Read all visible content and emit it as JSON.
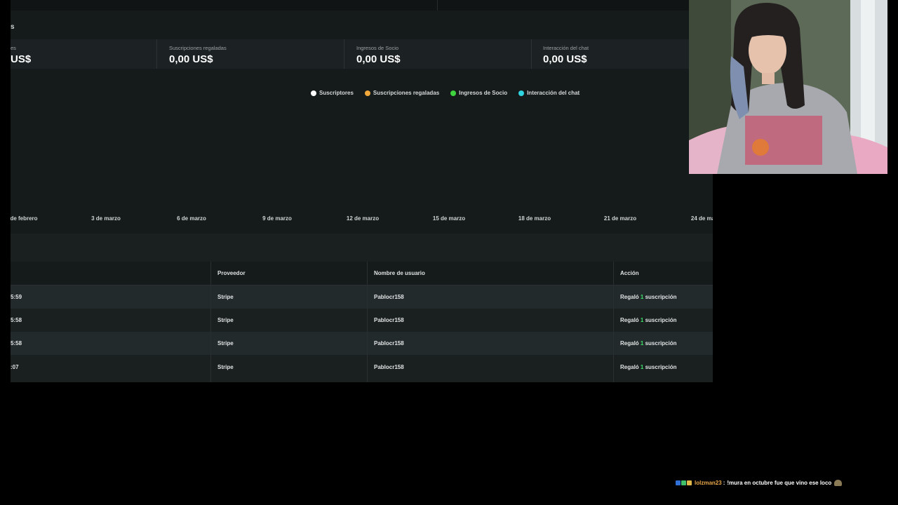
{
  "section": {
    "title_fragment": "s"
  },
  "stats": [
    {
      "label": "es",
      "value": "US$"
    },
    {
      "label": "Suscripciones regaladas",
      "value": "0,00 US$"
    },
    {
      "label": "Ingresos de Socio",
      "value": "0,00 US$"
    },
    {
      "label": "Interacción del chat",
      "value": "0,00 US$"
    }
  ],
  "legend": [
    {
      "label": "Suscriptores",
      "color": "#ffffff"
    },
    {
      "label": "Suscripciones regaladas",
      "color": "#f0a83a"
    },
    {
      "label": "Ingresos de Socio",
      "color": "#3fd43f"
    },
    {
      "label": "Interacción del chat",
      "color": "#2fd5e0"
    }
  ],
  "chart_data": {
    "type": "line",
    "x_ticks": [
      "de febrero",
      "3 de marzo",
      "6 de marzo",
      "9 de marzo",
      "12 de marzo",
      "15 de marzo",
      "18 de marzo",
      "21 de marzo",
      "24 de ma"
    ],
    "series": [
      {
        "name": "Suscriptores",
        "values": []
      },
      {
        "name": "Suscripciones regaladas",
        "values": []
      },
      {
        "name": "Ingresos de Socio",
        "values": []
      },
      {
        "name": "Interacción del chat",
        "values": []
      }
    ]
  },
  "table": {
    "headers": [
      "Proveedor",
      "Nombre de usuario",
      "Acción"
    ],
    "rows": [
      {
        "time": "5:59",
        "provider": "Stripe",
        "username": "Pablocr158",
        "action_prefix": "Regaló",
        "action_count": "1",
        "action_suffix": "suscripción"
      },
      {
        "time": "5:58",
        "provider": "Stripe",
        "username": "Pablocr158",
        "action_prefix": "Regaló",
        "action_count": "1",
        "action_suffix": "suscripción"
      },
      {
        "time": "5:58",
        "provider": "Stripe",
        "username": "Pablocr158",
        "action_prefix": "Regaló",
        "action_count": "1",
        "action_suffix": "suscripción"
      },
      {
        "time": ":07",
        "provider": "Stripe",
        "username": "Pablocr158",
        "action_prefix": "Regaló",
        "action_count": "1",
        "action_suffix": "suscripción"
      }
    ]
  },
  "chat": {
    "username": "lolzman23",
    "separator": ":",
    "message": "!mura en octubre fue que vino ese loco",
    "emote_icon": "snail-emote-icon"
  }
}
